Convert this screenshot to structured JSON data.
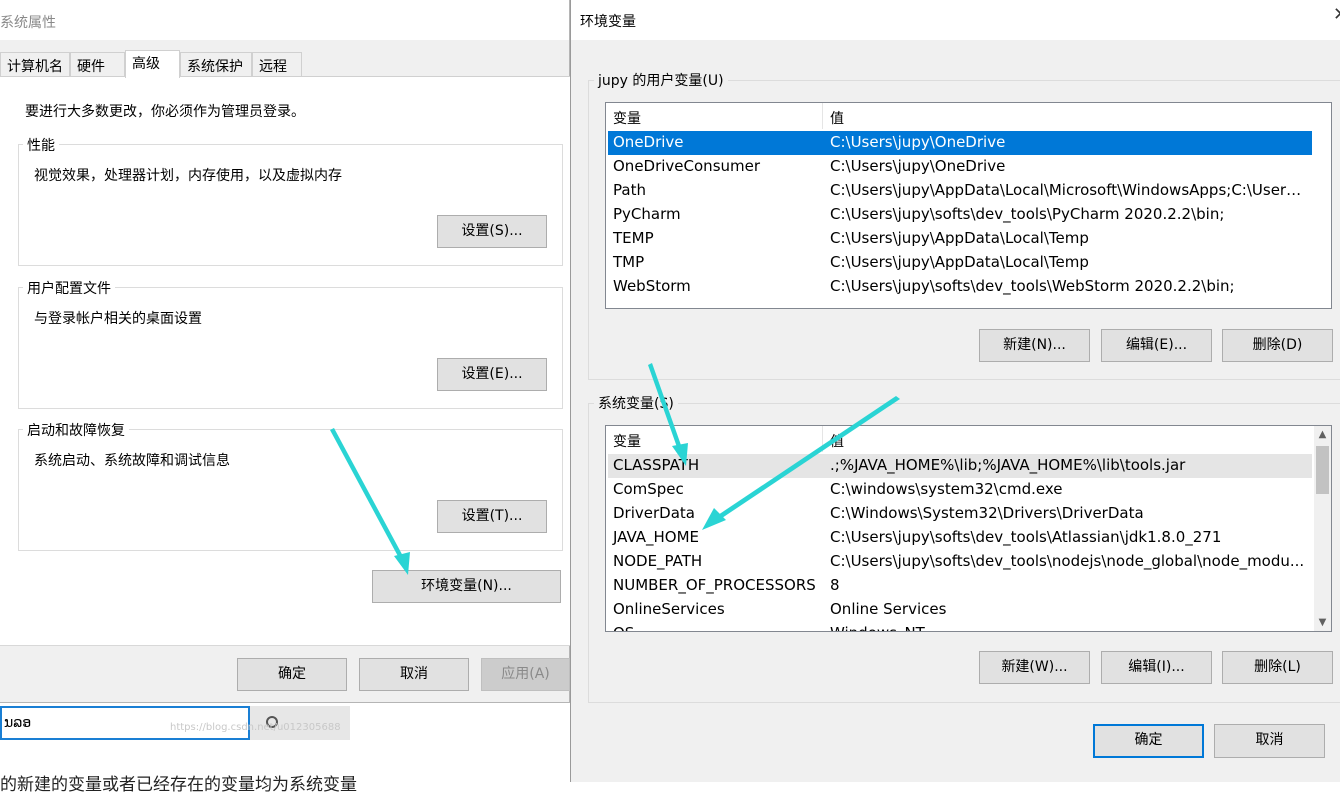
{
  "system_properties": {
    "title": "系统属性",
    "tabs": [
      {
        "label": "计算机名"
      },
      {
        "label": "硬件"
      },
      {
        "label": "高级",
        "active": true
      },
      {
        "label": "系统保护"
      },
      {
        "label": "远程"
      }
    ],
    "note": "要进行大多数更改，你必须作为管理员登录。",
    "groups": [
      {
        "label": "性能",
        "desc": "视觉效果，处理器计划，内存使用，以及虚拟内存",
        "button": "设置(S)..."
      },
      {
        "label": "用户配置文件",
        "desc": "与登录帐户相关的桌面设置",
        "button": "设置(E)..."
      },
      {
        "label": "启动和故障恢复",
        "desc": "系统启动、系统故障和调试信息",
        "button": "设置(T)..."
      }
    ],
    "env_button": "环境变量(N)...",
    "footer": {
      "ok": "确定",
      "cancel": "取消",
      "apply": "应用(A)"
    }
  },
  "env_vars": {
    "title": "环境变量",
    "user_section": {
      "label": "jupy 的用户变量(U)",
      "col_var": "变量",
      "col_val": "值",
      "rows": [
        {
          "name": "OneDrive",
          "value": "C:\\Users\\jupy\\OneDrive",
          "selected": true
        },
        {
          "name": "OneDriveConsumer",
          "value": "C:\\Users\\jupy\\OneDrive"
        },
        {
          "name": "Path",
          "value": "C:\\Users\\jupy\\AppData\\Local\\Microsoft\\WindowsApps;C:\\Users..."
        },
        {
          "name": "PyCharm",
          "value": "C:\\Users\\jupy\\softs\\dev_tools\\PyCharm 2020.2.2\\bin;"
        },
        {
          "name": "TEMP",
          "value": "C:\\Users\\jupy\\AppData\\Local\\Temp"
        },
        {
          "name": "TMP",
          "value": "C:\\Users\\jupy\\AppData\\Local\\Temp"
        },
        {
          "name": "WebStorm",
          "value": "C:\\Users\\jupy\\softs\\dev_tools\\WebStorm 2020.2.2\\bin;"
        }
      ],
      "buttons": {
        "new": "新建(N)...",
        "edit": "编辑(E)...",
        "delete": "删除(D)"
      }
    },
    "system_section": {
      "label": "系统变量(S)",
      "col_var": "变量",
      "col_val": "值",
      "rows": [
        {
          "name": "CLASSPATH",
          "value": ".;%JAVA_HOME%\\lib;%JAVA_HOME%\\lib\\tools.jar",
          "hover": true
        },
        {
          "name": "ComSpec",
          "value": "C:\\windows\\system32\\cmd.exe"
        },
        {
          "name": "DriverData",
          "value": "C:\\Windows\\System32\\Drivers\\DriverData"
        },
        {
          "name": "JAVA_HOME",
          "value": "C:\\Users\\jupy\\softs\\dev_tools\\Atlassian\\jdk1.8.0_271"
        },
        {
          "name": "NODE_PATH",
          "value": "C:\\Users\\jupy\\softs\\dev_tools\\nodejs\\node_global\\node_modu..."
        },
        {
          "name": "NUMBER_OF_PROCESSORS",
          "value": "8"
        },
        {
          "name": "OnlineServices",
          "value": "Online Services"
        },
        {
          "name": "OS",
          "value": "Windows_NT"
        }
      ],
      "buttons": {
        "new": "新建(W)...",
        "edit": "编辑(I)...",
        "delete": "删除(L)"
      }
    },
    "footer": {
      "ok": "确定",
      "cancel": "取消"
    }
  },
  "background": {
    "input_text": "ນລອ",
    "watermark": "https://blog.csdn.net/u012305688",
    "page_text": "的新建的变量或者已经存在的变量均为系统变量"
  },
  "colors": {
    "accent": "#0078d7",
    "annotation_arrow": "#2ad4d4"
  }
}
